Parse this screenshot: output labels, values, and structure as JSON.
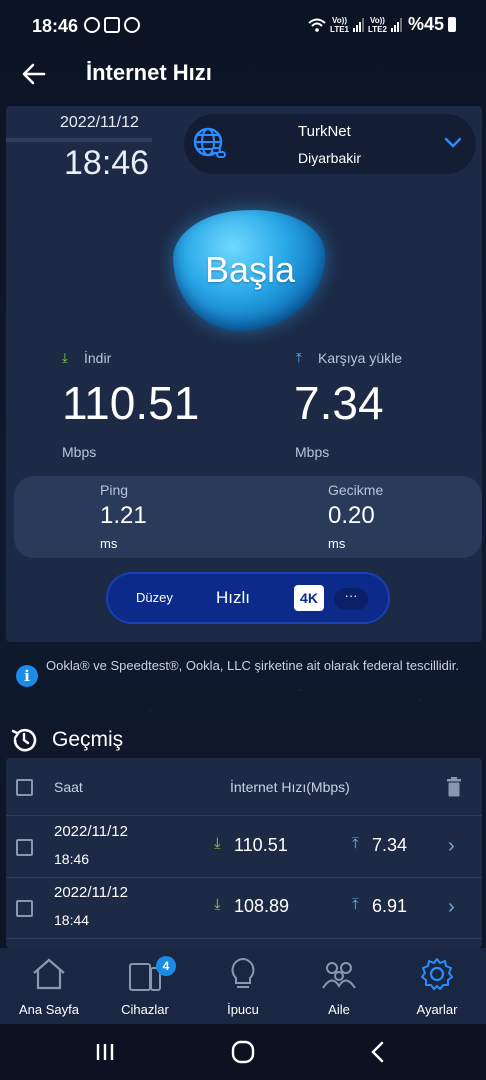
{
  "status_bar": {
    "time": "18:46",
    "sim1": "LTE1",
    "sim2": "LTE2",
    "volte": "Vo))",
    "battery": "%45"
  },
  "header": {
    "title": "İnternet Hızı"
  },
  "test": {
    "date": "2022/11/12",
    "time": "18:46",
    "isp": "TurkNet",
    "city": "Diyarbakir",
    "start_label": "Başla",
    "download_label": "İndir",
    "download_value": "110.51",
    "download_unit": "Mbps",
    "upload_label": "Karşıya yükle",
    "upload_value": "7.34",
    "upload_unit": "Mbps",
    "ping_label": "Ping",
    "ping_value": "1.21",
    "ping_unit": "ms",
    "latency_label": "Gecikme",
    "latency_value": "0.20",
    "latency_unit": "ms",
    "level_label": "Düzey",
    "level_value": "Hızlı",
    "level_badge": "4K",
    "level_more": "···"
  },
  "disclaimer": "Ookla® ve Speedtest®, Ookla, LLC şirketine ait olarak federal tescillidir.",
  "history": {
    "title": "Geçmiş",
    "col_time": "Saat",
    "col_speed": "İnternet Hızı(Mbps)",
    "rows": [
      {
        "date": "2022/11/12",
        "time": "18:46",
        "download": "110.51",
        "upload": "7.34"
      },
      {
        "date": "2022/11/12",
        "time": "18:44",
        "download": "108.89",
        "upload": "6.91"
      }
    ]
  },
  "bottom_nav": {
    "items": [
      {
        "label": "Ana Sayfa",
        "icon": "home-icon"
      },
      {
        "label": "Cihazlar",
        "icon": "devices-icon",
        "badge": "4"
      },
      {
        "label": "İpucu",
        "icon": "lightbulb-icon"
      },
      {
        "label": "Aile",
        "icon": "family-icon"
      },
      {
        "label": "Ayarlar",
        "icon": "settings-icon"
      }
    ]
  },
  "colors": {
    "background": "#0c1526",
    "card": "#1c2a45",
    "accent_blue": "#1a8ce8",
    "download_green": "#8bd44c",
    "upload_blue": "#5fb4ff",
    "level_bar": "#0b2a8a",
    "active_nav": "#2a8cff"
  }
}
